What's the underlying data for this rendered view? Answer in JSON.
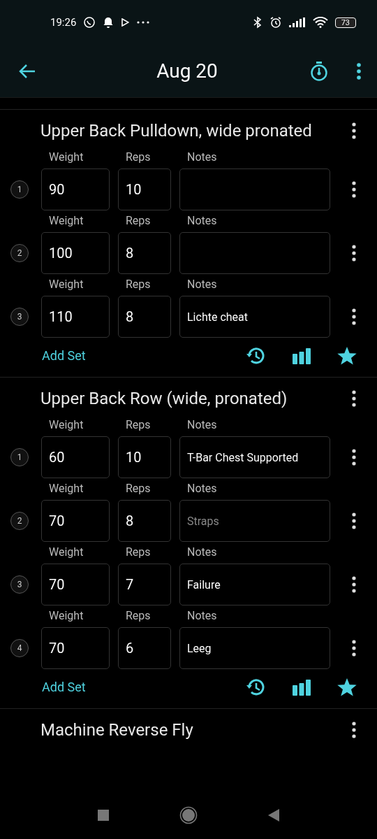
{
  "status_bar": {
    "time": "19:26",
    "battery": "73"
  },
  "app_bar": {
    "title": "Aug 20"
  },
  "exercises": [
    {
      "name": "Upper Back Pulldown, wide pronated",
      "add_set": "Add Set",
      "sets": [
        {
          "number": "1",
          "weight_label": "Weight",
          "reps_label": "Reps",
          "notes_label": "Notes",
          "weight": "90",
          "reps": "10"
        },
        {
          "number": "2",
          "weight_label": "Weight",
          "reps_label": "Reps",
          "notes_label": "Notes",
          "weight": "100",
          "reps": "8"
        },
        {
          "number": "3",
          "weight_label": "Weight",
          "reps_label": "Reps",
          "notes_label": "Notes",
          "weight": "110",
          "reps": "8",
          "notes": "Lichte cheat"
        }
      ]
    },
    {
      "name": "Upper Back Row (wide, pronated)",
      "add_set": "Add Set",
      "sets": [
        {
          "number": "1",
          "weight_label": "Weight",
          "reps_label": "Reps",
          "notes_label": "Notes",
          "weight": "60",
          "reps": "10",
          "notes": "T-Bar Chest Supported"
        },
        {
          "number": "2",
          "weight_label": "Weight",
          "reps_label": "Reps",
          "notes_label": "Notes",
          "weight": "70",
          "reps": "8",
          "placeholder": "Straps"
        },
        {
          "number": "3",
          "weight_label": "Weight",
          "reps_label": "Reps",
          "notes_label": "Notes",
          "weight": "70",
          "reps": "7",
          "notes": "Failure"
        },
        {
          "number": "4",
          "weight_label": "Weight",
          "reps_label": "Reps",
          "notes_label": "Notes",
          "weight": "70",
          "reps": "6",
          "notes": "Leeg"
        }
      ]
    },
    {
      "name": "Machine Reverse Fly"
    }
  ]
}
